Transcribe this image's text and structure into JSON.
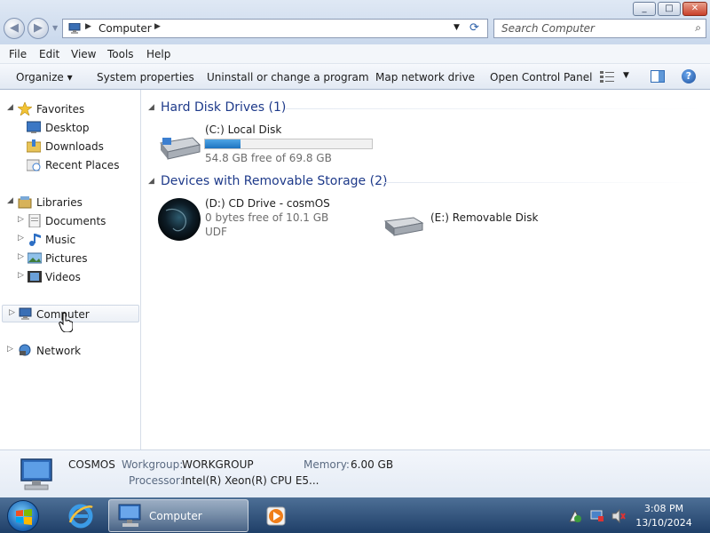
{
  "window": {
    "title_controls": {
      "min": "_",
      "max": "□",
      "close": "✕"
    }
  },
  "address": {
    "crumb": "Computer"
  },
  "search": {
    "placeholder": "Search Computer"
  },
  "menu": [
    "File",
    "Edit",
    "View",
    "Tools",
    "Help"
  ],
  "toolbar": {
    "organize": "Organize ▾",
    "system_properties": "System properties",
    "uninstall": "Uninstall or change a program",
    "map_drive": "Map network drive",
    "control_panel": "Open Control Panel",
    "help": "?"
  },
  "nav": {
    "favorites": "Favorites",
    "desktop": "Desktop",
    "downloads": "Downloads",
    "recent": "Recent Places",
    "libraries": "Libraries",
    "documents": "Documents",
    "music": "Music",
    "pictures": "Pictures",
    "videos": "Videos",
    "computer": "Computer",
    "network": "Network"
  },
  "groups": {
    "hdd": "Hard Disk Drives (1)",
    "removable": "Devices with Removable Storage (2)"
  },
  "drives": {
    "c": {
      "name": "(C:) Local Disk",
      "free": "54.8 GB free of 69.8 GB",
      "used_fraction": 0.215
    },
    "d": {
      "name": "(D:) CD Drive - cosmOS",
      "free": "0 bytes free of 10.1 GB",
      "fs": "UDF"
    },
    "e": {
      "name": "(E:) Removable Disk"
    }
  },
  "details": {
    "name": "COSMOS",
    "workgroup_label": "Workgroup:",
    "workgroup": "WORKGROUP",
    "memory_label": "Memory:",
    "memory": "6.00 GB",
    "processor_label": "Processor:",
    "processor": "Intel(R) Xeon(R) CPU E5..."
  },
  "taskbar": {
    "active_item": "Computer",
    "time": "3:08 PM",
    "date": "13/10/2024"
  },
  "colors": {
    "group_title": "#1e3a8a",
    "progress": "#1e73c0",
    "taskbar": "#2a4a73"
  }
}
